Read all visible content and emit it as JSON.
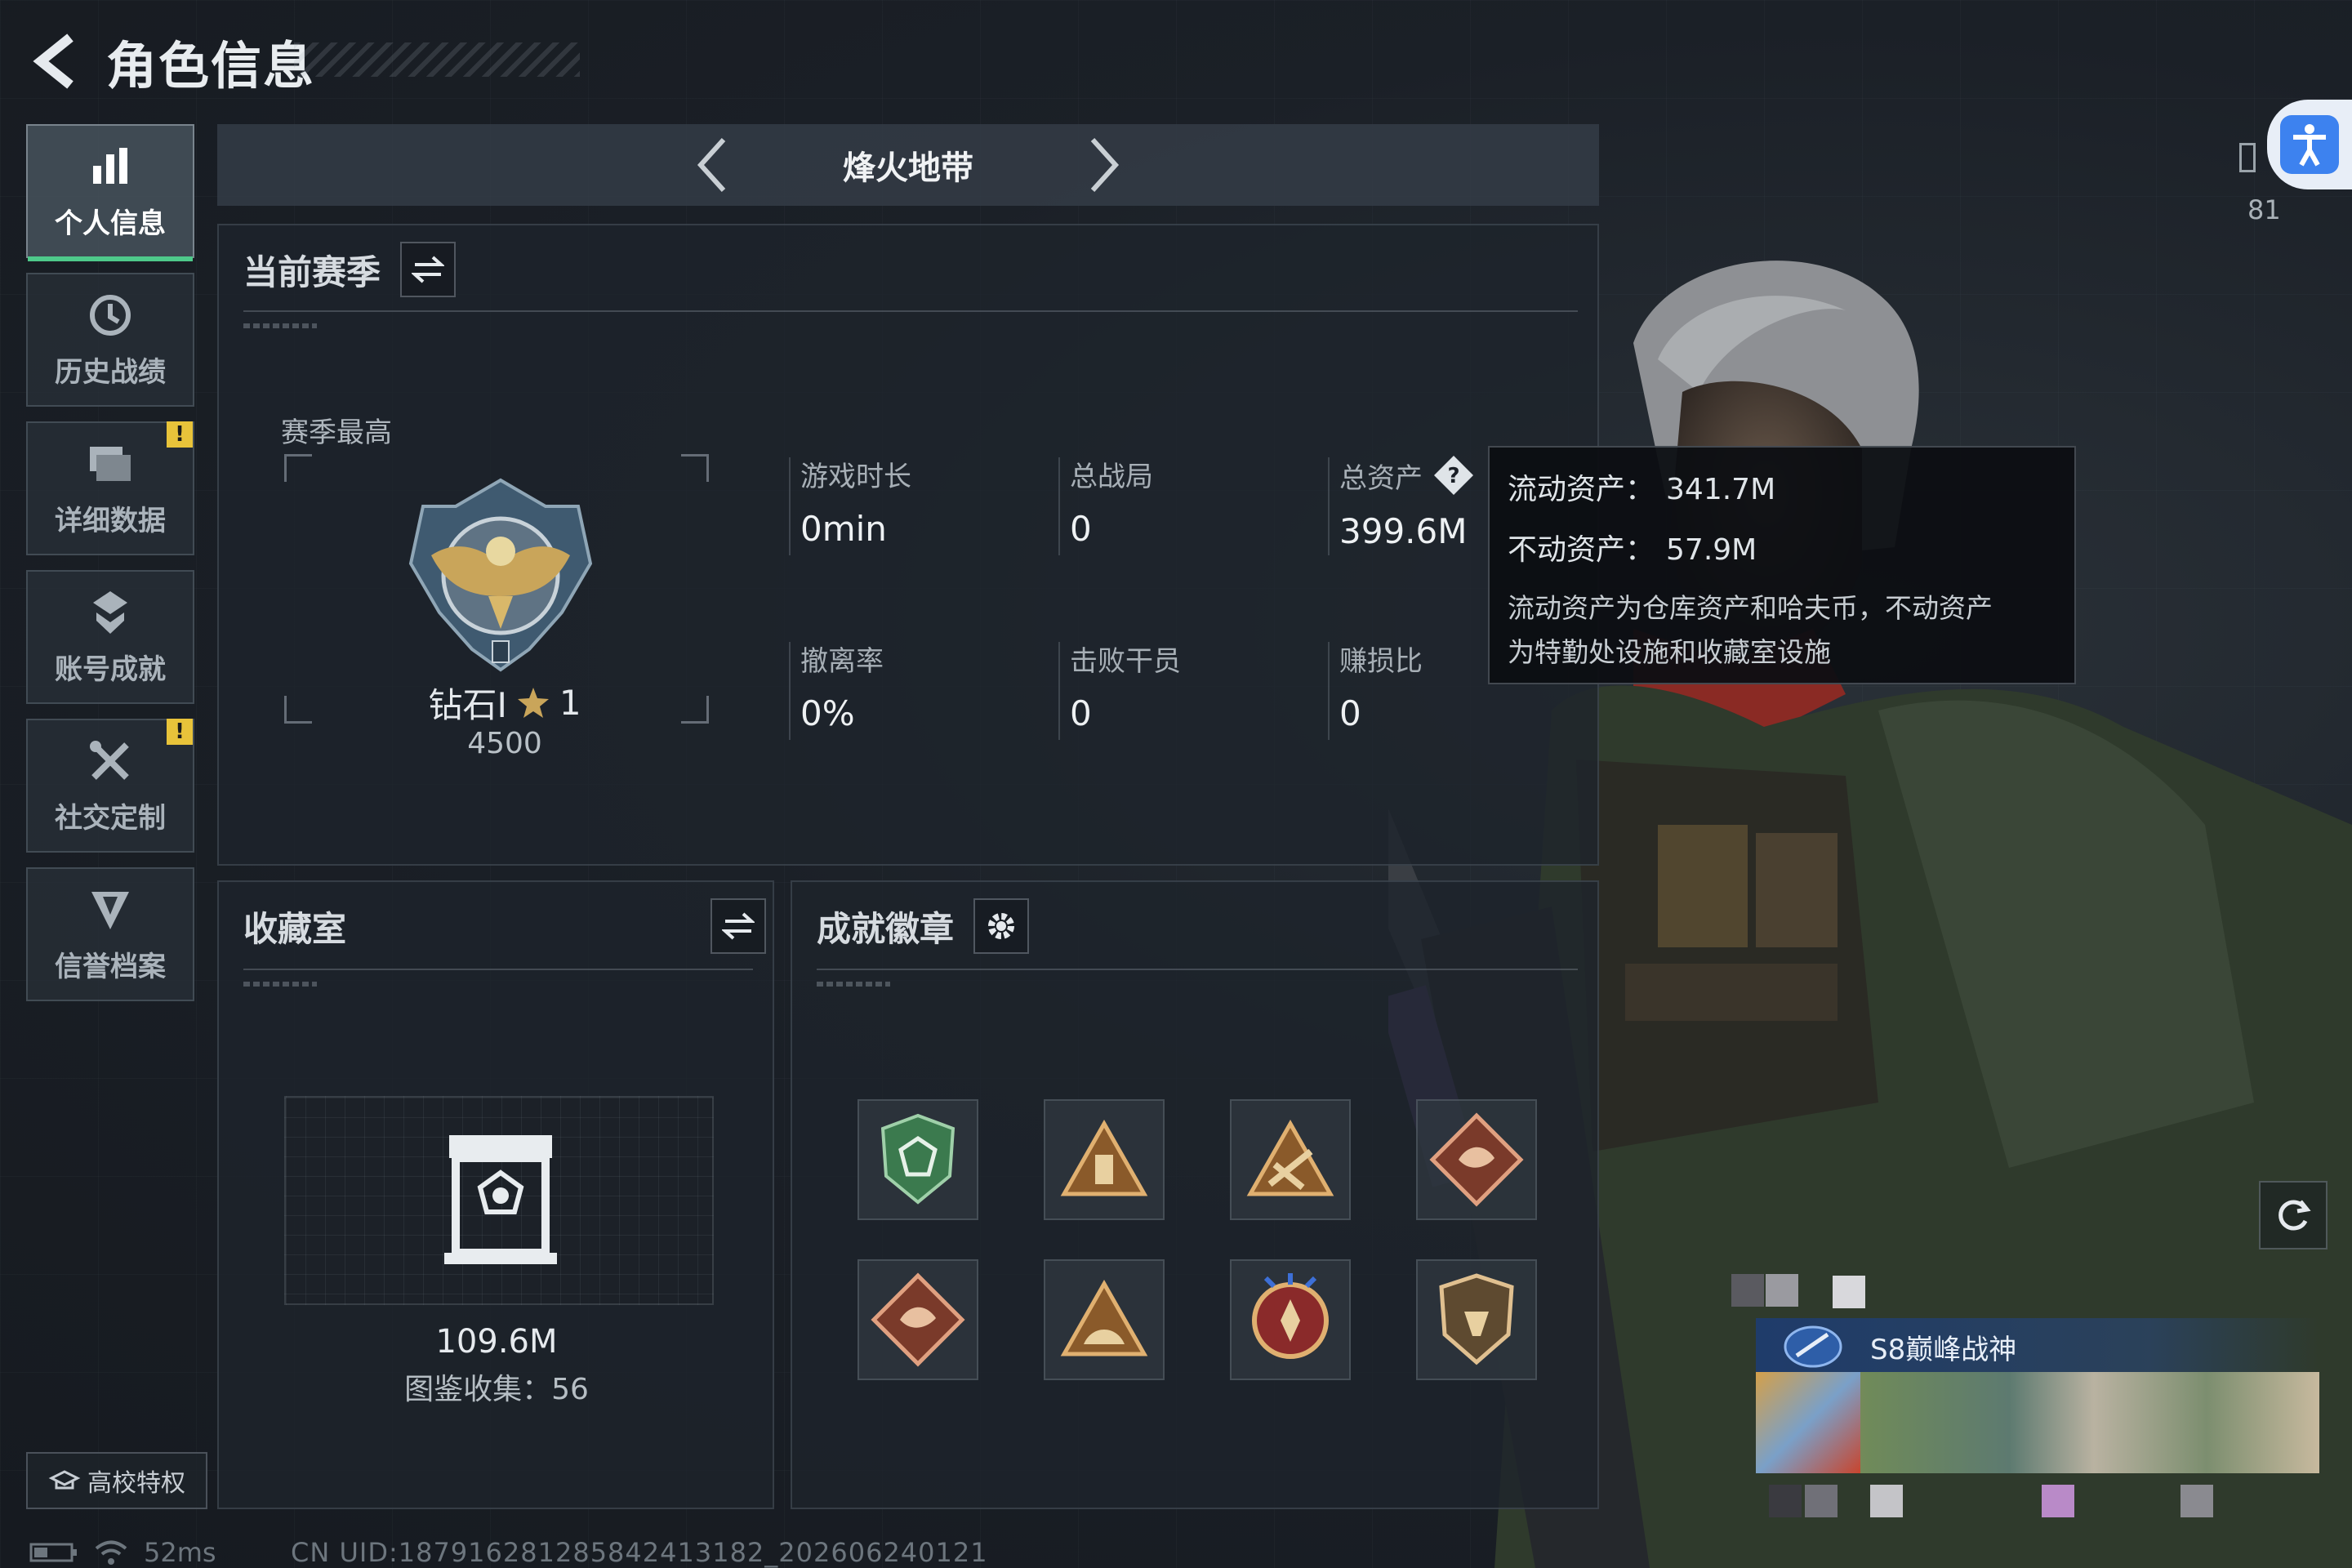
{
  "header": {
    "title": "角色信息"
  },
  "sidebar": {
    "items": [
      {
        "label": "个人信息",
        "icon": "bar-chart-icon",
        "active": true,
        "warning": false
      },
      {
        "label": "历史战绩",
        "icon": "history-icon",
        "active": false,
        "warning": false
      },
      {
        "label": "详细数据",
        "icon": "folder-icon",
        "active": false,
        "warning": true
      },
      {
        "label": "账号成就",
        "icon": "achievement-icon",
        "active": false,
        "warning": false
      },
      {
        "label": "社交定制",
        "icon": "tools-icon",
        "active": false,
        "warning": true
      },
      {
        "label": "信誉档案",
        "icon": "shield-icon",
        "active": false,
        "warning": false
      }
    ],
    "warning_mark": "!",
    "school_button": "高校特权"
  },
  "mode": {
    "title": "烽火地带"
  },
  "season": {
    "title": "当前赛季",
    "best_label": "赛季最高",
    "rank_name": "钻石Ⅰ",
    "rank_stars": "1",
    "rank_points": "4500",
    "stats": [
      {
        "label": "游戏时长",
        "value": "0min"
      },
      {
        "label": "总战局",
        "value": "0"
      },
      {
        "label": "总资产",
        "value": "399.6M",
        "help": true
      },
      {
        "label": "撤离率",
        "value": "0%"
      },
      {
        "label": "击败干员",
        "value": "0"
      },
      {
        "label": "赚损比",
        "value": "0"
      }
    ]
  },
  "tooltip": {
    "liquid_label": "流动资产：",
    "liquid_value": "341.7M",
    "fixed_label": "不动资产：",
    "fixed_value": "57.9M",
    "note_line1": "流动资产为仓库资产和哈夫币，不动资产",
    "note_line2": "为特勤处设施和收藏室设施"
  },
  "collection": {
    "title": "收藏室",
    "value": "109.6M",
    "count_text": "图鉴收集：56"
  },
  "achievements": {
    "title": "成就徽章"
  },
  "profile": {
    "level": "81",
    "title_text": "S8巅峰战神"
  },
  "status": {
    "ping": "52ms",
    "uid": "CN UID:187916281285842413182_202606240121"
  },
  "colors": {
    "accent_green": "#4ec98a",
    "warning_yellow": "#e8c33a",
    "access_blue": "#3d82ef"
  }
}
